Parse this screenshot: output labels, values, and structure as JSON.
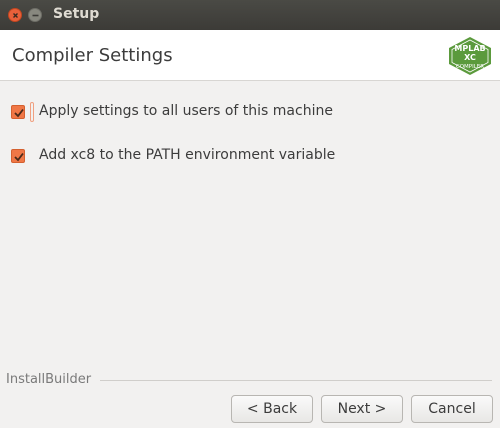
{
  "window": {
    "title": "Setup"
  },
  "header": {
    "title": "Compiler Settings",
    "logo_text": [
      "MPLAB",
      "XC",
      "COMPILER"
    ]
  },
  "options": [
    {
      "label": "Apply settings to all users of this machine",
      "checked": true
    },
    {
      "label": "Add xc8 to the PATH environment variable",
      "checked": true
    }
  ],
  "footer": {
    "brand": "InstallBuilder"
  },
  "buttons": {
    "back": "< Back",
    "next": "Next >",
    "cancel": "Cancel"
  },
  "colors": {
    "accent": "#f07746",
    "titlebar": "#3c3b37",
    "logo": "#5b9a3c"
  }
}
